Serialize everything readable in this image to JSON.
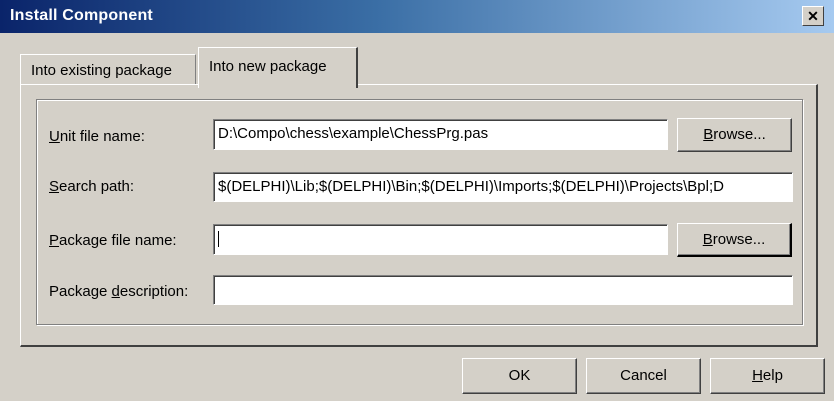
{
  "window": {
    "title": "Install Component"
  },
  "tabs": [
    {
      "label": "Into existing package",
      "selected": false
    },
    {
      "label": "Into new package",
      "selected": true
    }
  ],
  "form": {
    "unit_file": {
      "label_prefix": "",
      "label_accel": "U",
      "label_rest": "nit file name:",
      "value": "D:\\Compo\\chess\\example\\ChessPrg.pas"
    },
    "search_path": {
      "label_accel": "S",
      "label_rest": "earch path:",
      "value": "$(DELPHI)\\Lib;$(DELPHI)\\Bin;$(DELPHI)\\Imports;$(DELPHI)\\Projects\\Bpl;D"
    },
    "package_file": {
      "label_accel": "P",
      "label_rest": "ackage file name:",
      "value": ""
    },
    "package_description": {
      "label_prefix": "Package ",
      "label_accel": "d",
      "label_rest": "escription:",
      "value": ""
    }
  },
  "buttons": {
    "browse_unit": {
      "accel_prefix": "",
      "accel": "B",
      "rest": "rowse..."
    },
    "browse_package": {
      "accel_prefix": "",
      "accel": "B",
      "rest": "rowse..."
    },
    "ok": "OK",
    "cancel": "Cancel",
    "help": {
      "accel": "H",
      "rest": "elp"
    }
  },
  "colors": {
    "face": "#d4d0c8",
    "title_start": "#0a246a",
    "title_end": "#a6caf0"
  }
}
